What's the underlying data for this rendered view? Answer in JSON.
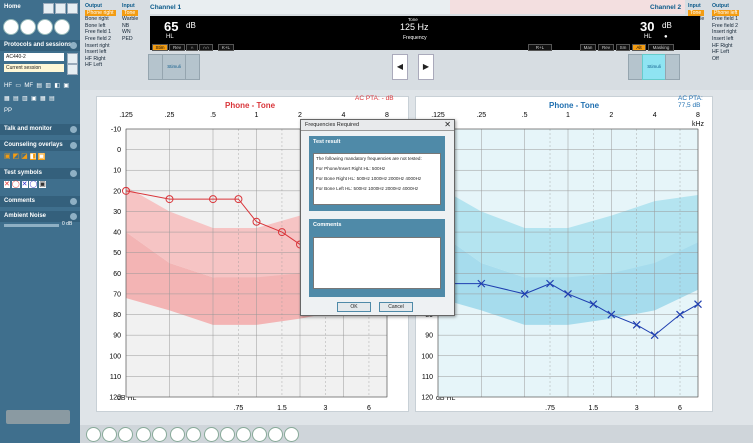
{
  "sidebar": {
    "home": "Home",
    "sections": [
      "Protocols and sessions",
      "Talk and monitor",
      "Counseling overlays",
      "Test symbols",
      "Comments",
      "Ambient Noise"
    ],
    "protocol_value": "AC440-2",
    "session_value": "Current session",
    "ambient_value": "0 dB"
  },
  "channel1": {
    "label": "Channel 1",
    "output_header": "Output",
    "output_items": [
      "Phone right",
      "Bone right",
      "Bone left",
      "Free field 1",
      "Free field 2",
      "Insert right",
      "Insert left",
      "HF Right",
      "HF Left"
    ],
    "output_selected": "Phone right",
    "input_header": "Input",
    "input_items": [
      "Tone",
      "Warble",
      "NB",
      "WN",
      "PED"
    ],
    "input_selected": "Tone",
    "level": "65",
    "level_unit": "dB",
    "level_sub": "HL",
    "tone_label": "Tone",
    "freq": "125 Hz",
    "freq_sub": "Frequency",
    "indicators": [
      "Stim",
      "Rev",
      "∩",
      "∩∩",
      "K+L"
    ],
    "stimuli_label": "Stimuli"
  },
  "channel2": {
    "label": "Channel 2",
    "output_header": "Output",
    "output_items": [
      "Phone left",
      "Free field 1",
      "Free field 2",
      "Insert right",
      "Insert left",
      "HF Right",
      "HF Left",
      "Off"
    ],
    "output_selected": "Phone left",
    "input_header": "Input",
    "input_items": [
      "Tone",
      "Warble",
      "NB",
      "WN",
      "TEN",
      "PED"
    ],
    "input_selected": "Tone",
    "level": "30",
    "level_unit": "dB",
    "level_sub": "HL",
    "indicators": [
      "R+L",
      "Man",
      "Rev",
      "Sm",
      "Alt",
      "Masking"
    ],
    "stimuli_label": "Stimuli"
  },
  "left_graph": {
    "title": "Phone - Tone",
    "pta": "AC PTA:  - dB",
    "top_ticks": [
      ".125",
      ".25",
      ".5",
      "1",
      "2",
      "4",
      "8"
    ],
    "bottom_ticks": [
      ".75",
      "1.5",
      "3",
      "6"
    ],
    "y_ticks": [
      "-10",
      "0",
      "10",
      "20",
      "30",
      "40",
      "50",
      "60",
      "70",
      "80",
      "90",
      "100",
      "110",
      "120"
    ],
    "unit": "dB HL",
    "accent": "#d9353a"
  },
  "right_graph": {
    "title": "Phone - Tone",
    "pta": "AC PTA:  77,5 dB",
    "khz": "kHz",
    "top_ticks": [
      ".125",
      ".25",
      ".5",
      "1",
      "2",
      "4",
      "8"
    ],
    "bottom_ticks": [
      ".75",
      "1.5",
      "3",
      "6"
    ],
    "y_ticks": [
      "-10",
      "0",
      "10",
      "20",
      "30",
      "40",
      "50",
      "60",
      "70",
      "80",
      "90",
      "100",
      "110",
      "120"
    ],
    "unit": "dB HL",
    "accent": "#1f3fb0"
  },
  "dialog": {
    "title": "Frequencies Required",
    "close": "✕",
    "section1": "Test result",
    "message_lines": [
      "The following mandatory frequencies are not tested:",
      "",
      "For Phone/Insert Right HL: 500Hz",
      "",
      "For Bone Right HL: 500Hz 1000Hz 2000Hz 4000Hz",
      "",
      "For Bone Left HL: 500Hz 1000Hz 2000Hz 4000Hz"
    ],
    "section2": "Comments",
    "ok": "OK",
    "cancel": "Cancel"
  },
  "chart_data": [
    {
      "type": "line",
      "title": "Phone - Tone",
      "series": [
        {
          "values": [
            20,
            24,
            24,
            24,
            35,
            40,
            46
          ]
        }
      ],
      "x": [
        125,
        250,
        500,
        750,
        1000,
        1500,
        2000
      ],
      "ylabel": "dB HL",
      "ylim": [
        120,
        -10
      ],
      "grid": true
    },
    {
      "type": "line",
      "title": "Phone - Tone",
      "series": [
        {
          "values": [
            65,
            65,
            70,
            65,
            70,
            75,
            80,
            85,
            90,
            80,
            75
          ]
        }
      ],
      "x": [
        200,
        250,
        500,
        750,
        1000,
        1500,
        2000,
        3000,
        4000,
        6000,
        8000
      ],
      "ylabel": "dB HL",
      "ylim": [
        120,
        -10
      ],
      "grid": true
    }
  ]
}
